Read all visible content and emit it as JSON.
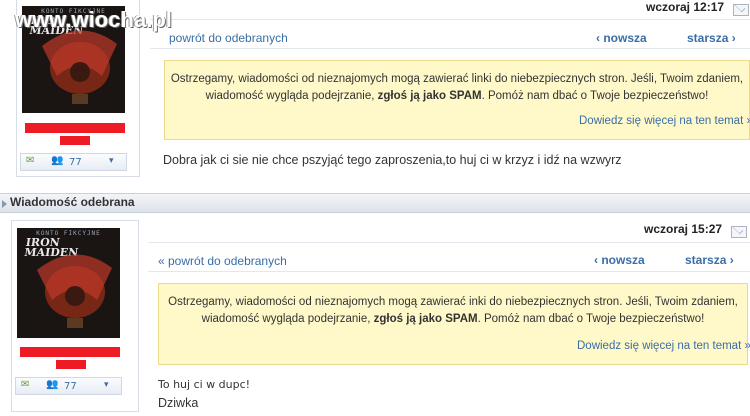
{
  "watermark": "www.wiocha.pl",
  "messages": [
    {
      "avatar_label": "KONTO FIKCYJNE",
      "avatar_logo": "IRON MAIDEN",
      "tool_count": "77",
      "date": "wczoraj 12:17",
      "back_link": "powrót do odebranych",
      "prev_label": "‹ nowsza",
      "next_label": "starsza ›",
      "warning_line1": "Ostrzegamy, wiadomości od nieznajomych mogą zawierać linki do niebezpiecznych stron. Jeśli, Twoim zdaniem,",
      "warning_line2_a": "wiadomość wygląda podejrzanie, ",
      "warning_line2_b": "zgłoś ją jako SPAM",
      "warning_line2_c": ". Pomóż nam dbać o Twoje bezpieczeństwo!",
      "learn_more": "Dowiedz się więcej na ten temat »",
      "body_lines": [
        "Dobra jak ci sie nie chce pszyjąć tego zaproszenia,to huj ci w krzyz i idź na wzwyrz"
      ]
    },
    {
      "section_title": "Wiadomość odebrana",
      "avatar_label": "KONTO FIKCYJNE",
      "avatar_logo": "IRON MAIDEN",
      "tool_count": "77",
      "date": "wczoraj 15:27",
      "back_link": "« powrót do odebranych",
      "prev_label": "‹ nowsza",
      "next_label": "starsza ›",
      "warning_line1": "Ostrzegamy, wiadomości od nieznajomych mogą zawierać inki do niebezpiecznych stron. Jeśli, Twoim zdaniem,",
      "warning_line2_a": "wiadomość wygląda podejrzanie, ",
      "warning_line2_b": "zgłoś ją jako SPAM",
      "warning_line2_c": ". Pomóż nam dbać o Twoje bezpieczeństwo!",
      "learn_more": "Dowiedz się więcej na ten temat »",
      "body_lines": [
        "To huj ci w dupc!",
        "Dziwka"
      ]
    }
  ]
}
